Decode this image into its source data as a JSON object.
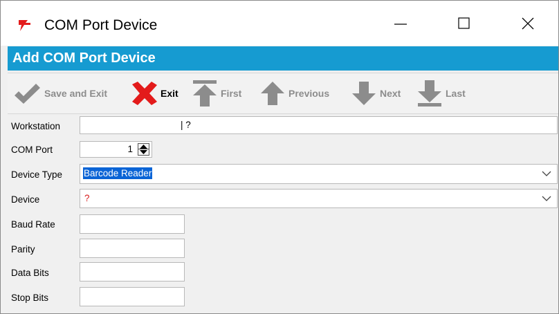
{
  "window": {
    "title": "COM Port Device",
    "icon": "red-app-icon",
    "minimize_icon": "minimize-icon",
    "maximize_icon": "maximize-icon",
    "close_icon": "close-icon"
  },
  "banner": {
    "title": "Add COM Port Device",
    "color": "#169bd1"
  },
  "toolbar": {
    "save_exit": "Save and Exit",
    "exit": "Exit",
    "first": "First",
    "previous": "Previous",
    "next": "Next",
    "last": "Last"
  },
  "form": {
    "workstation": {
      "label": "Workstation",
      "value": "| ?"
    },
    "com_port": {
      "label": "COM Port",
      "value": "1"
    },
    "device_type": {
      "label": "Device Type",
      "value": "Barcode Reader"
    },
    "device": {
      "label": "Device",
      "value": "?"
    },
    "baud_rate": {
      "label": "Baud Rate",
      "value": ""
    },
    "parity": {
      "label": "Parity",
      "value": ""
    },
    "data_bits": {
      "label": "Data Bits",
      "value": ""
    },
    "stop_bits": {
      "label": "Stop Bits",
      "value": ""
    }
  }
}
